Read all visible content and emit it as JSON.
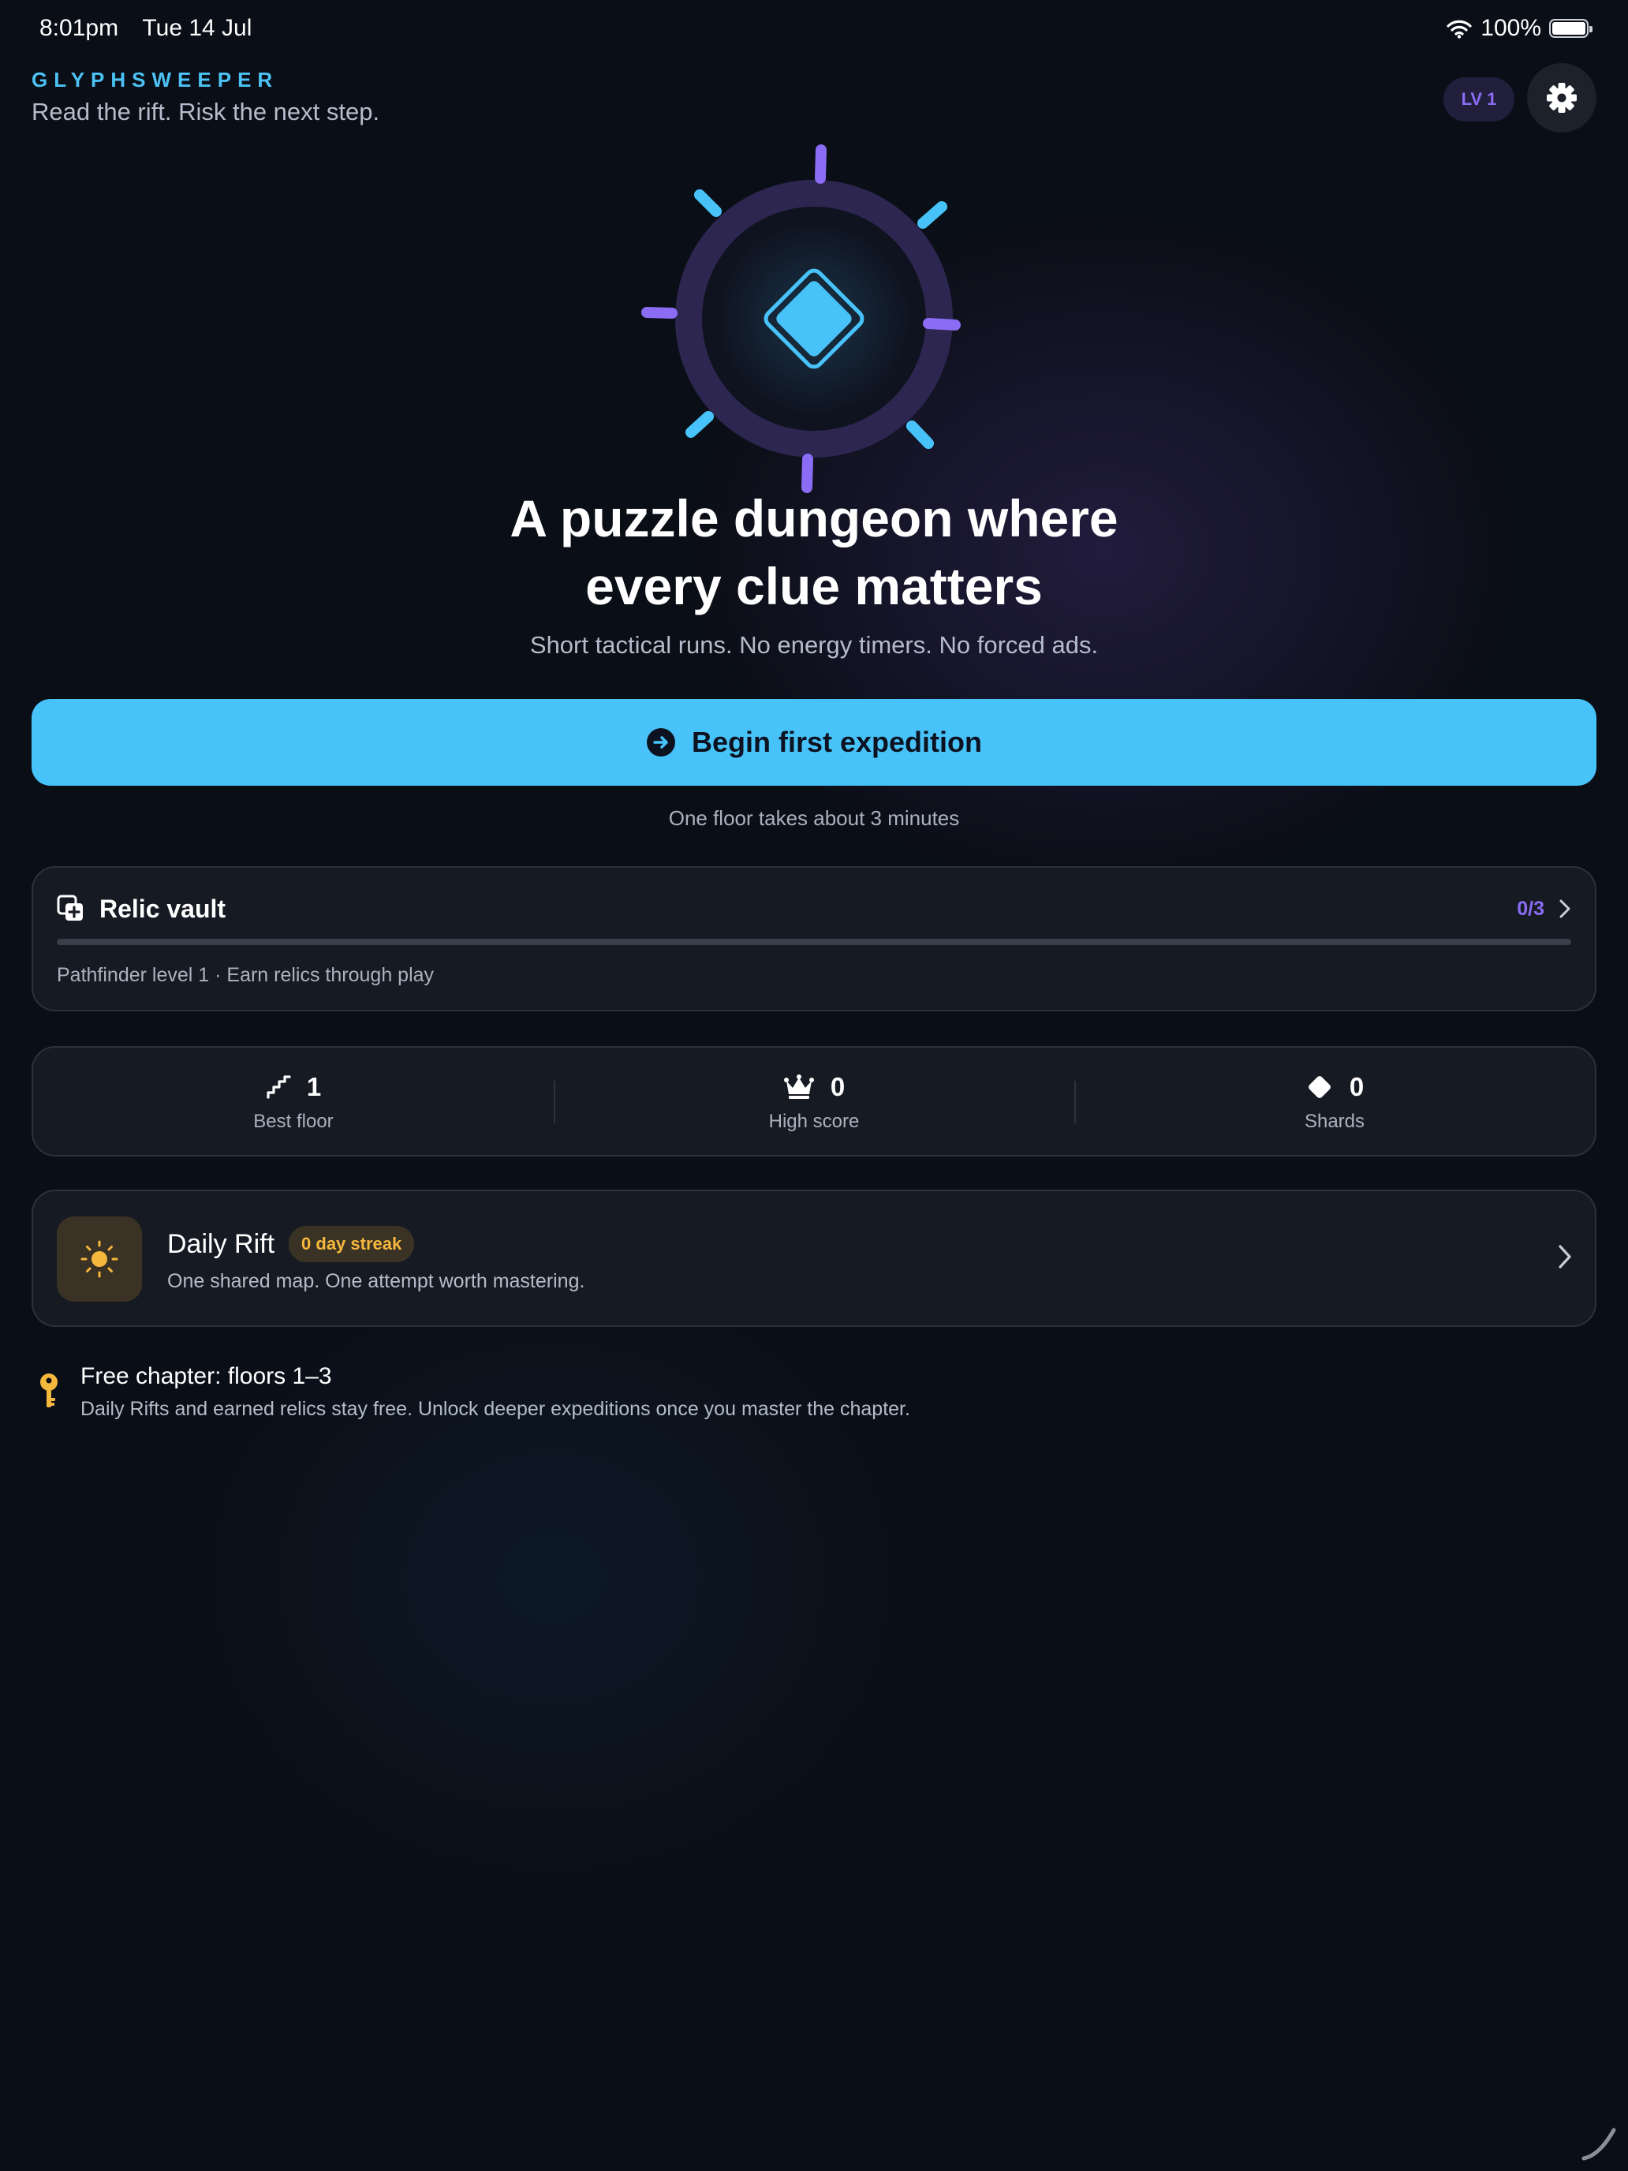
{
  "status_bar": {
    "time": "8:01pm",
    "date": "Tue 14 Jul",
    "battery": "100%"
  },
  "header": {
    "brand": "GLYPHSWEEPER",
    "tagline": "Read the rift. Risk the next step.",
    "level_badge": "LV 1"
  },
  "hero": {
    "title_line1": "A puzzle dungeon where",
    "title_line2": "every clue matters",
    "subtitle": "Short tactical runs. No energy timers. No forced ads."
  },
  "primary_action": {
    "label": "Begin first expedition",
    "caption": "One floor takes about 3 minutes"
  },
  "relic_vault": {
    "title": "Relic vault",
    "count": "0/3",
    "progress": 0,
    "subtitle": "Pathfinder level 1 · Earn relics through play"
  },
  "stats": [
    {
      "icon": "stairs-icon",
      "value": "1",
      "label": "Best floor"
    },
    {
      "icon": "crown-icon",
      "value": "0",
      "label": "High score"
    },
    {
      "icon": "diamond-icon",
      "value": "0",
      "label": "Shards"
    }
  ],
  "daily_rift": {
    "title": "Daily Rift",
    "streak": "0 day streak",
    "subtitle": "One shared map. One attempt worth mastering."
  },
  "free_chapter": {
    "title": "Free chapter: floors 1–3",
    "subtitle": "Daily Rifts and earned relics stay free. Unlock deeper expeditions once you master the chapter."
  },
  "colors": {
    "background": "#0a0e16",
    "accent_cyan": "#48c3fa",
    "accent_purple": "#8b6cf5",
    "accent_gold": "#f5b83d",
    "card": "#161a22"
  }
}
